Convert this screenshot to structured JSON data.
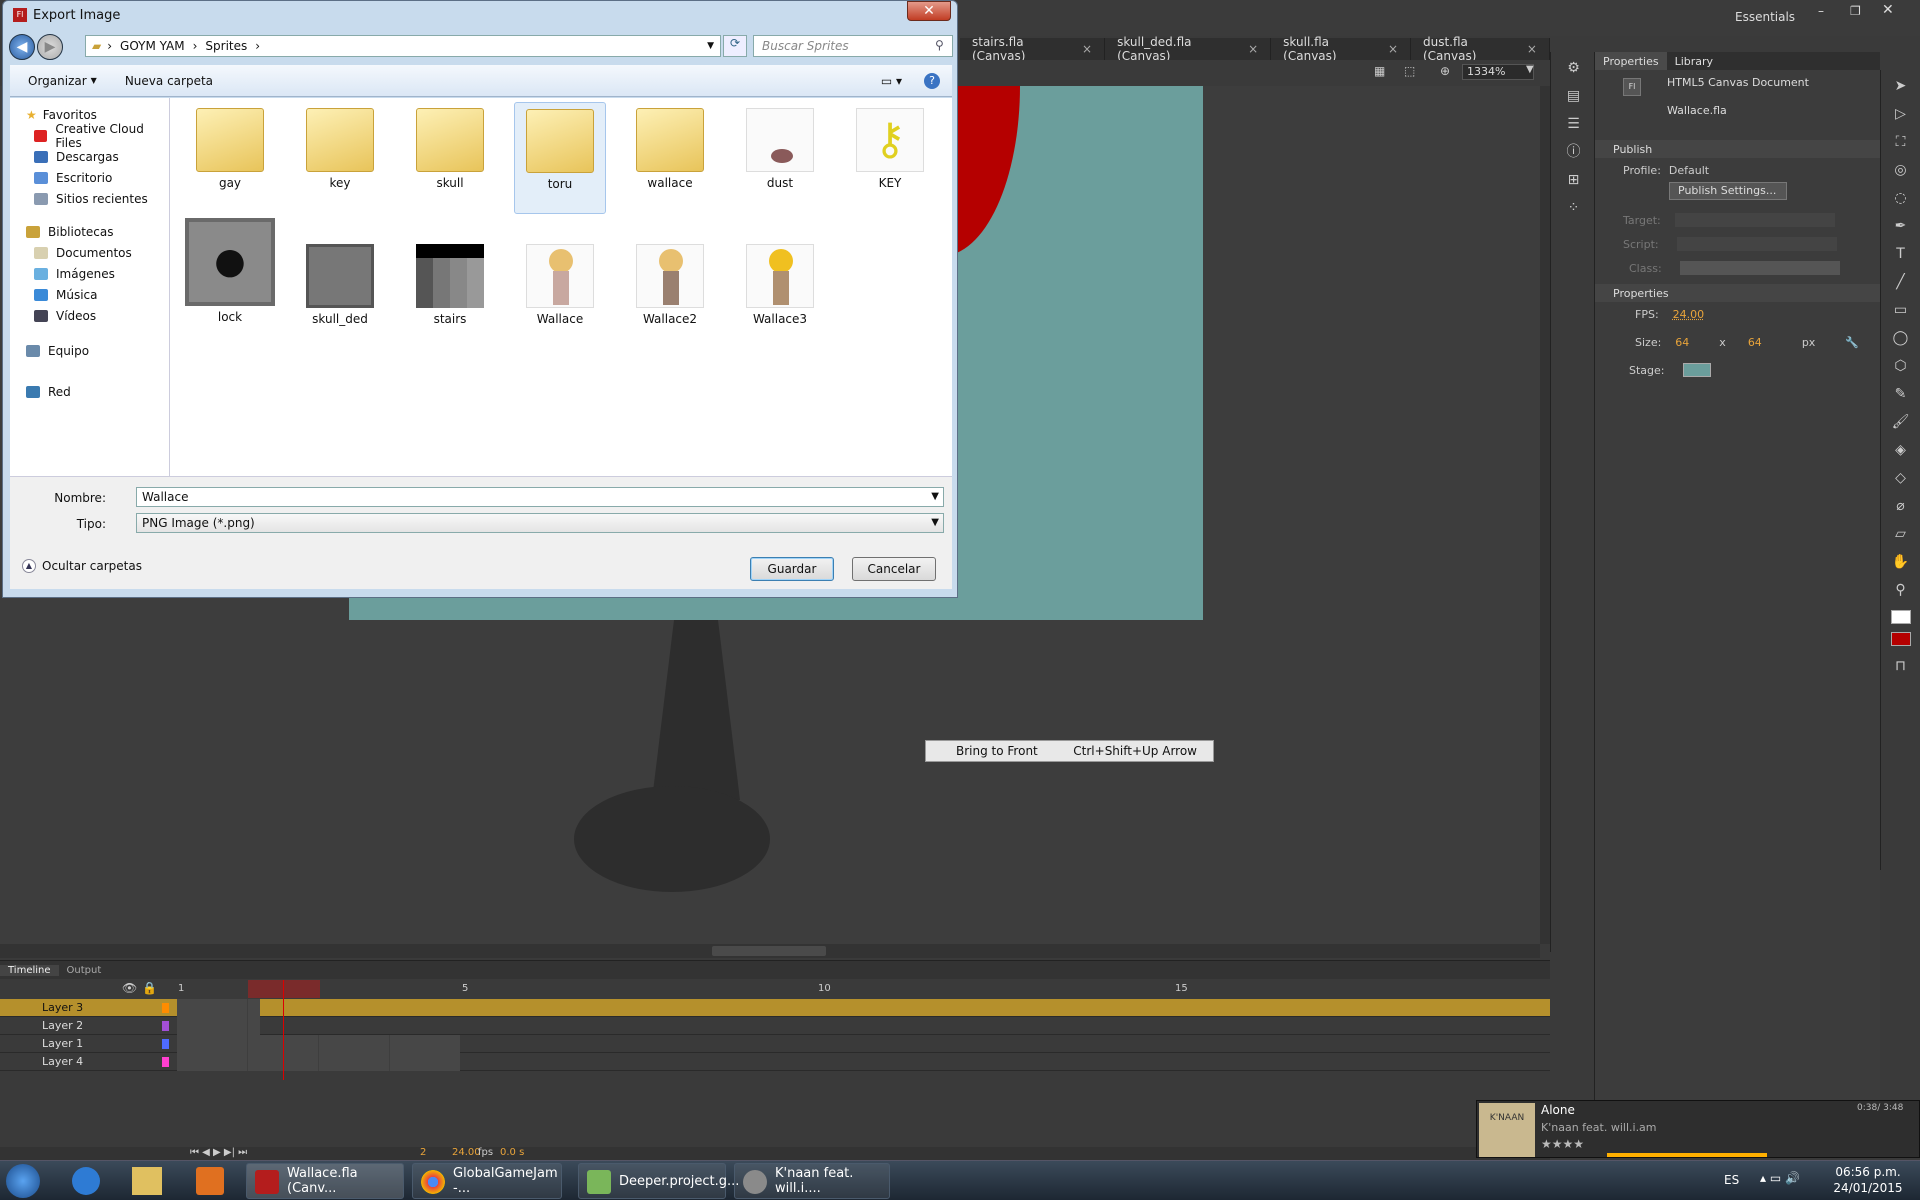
{
  "window_tabs": [
    "stairs.fla (Canvas)",
    "skull_ded.fla (Canvas)",
    "skull.fla (Canvas)",
    "dust.fla (Canvas)"
  ],
  "workspace": "Essentials",
  "zoom": "1334%",
  "context_menu": {
    "label": "Bring to Front",
    "shortcut": "Ctrl+Shift+Up Arrow"
  },
  "properties_panel": {
    "tabs": [
      "Properties",
      "Library"
    ],
    "doc_type": "HTML5 Canvas Document",
    "doc_name": "Wallace.fla",
    "publish_header": "Publish",
    "profile_label": "Profile:",
    "profile_value": "Default",
    "publish_settings": "Publish Settings...",
    "target_label": "Target:",
    "script_label": "Script:",
    "class_label": "Class:",
    "props_header": "Properties",
    "fps_label": "FPS:",
    "fps": "24.00",
    "size_label": "Size:",
    "width": "64",
    "x": "x",
    "height": "64",
    "px": "px",
    "stage_label": "Stage:",
    "stage_color": "#6b9e9c"
  },
  "timeline": {
    "tabs": [
      "Timeline",
      "Output"
    ],
    "frame_numbers": [
      "1",
      "5",
      "10",
      "15"
    ],
    "layers": [
      {
        "name": "Layer 3",
        "color": "#ff8c00"
      },
      {
        "name": "Layer 2",
        "color": "#a34fd6"
      },
      {
        "name": "Layer 1",
        "color": "#4f6bff"
      },
      {
        "name": "Layer 4",
        "color": "#ff3fd0"
      }
    ],
    "current_frame": "2",
    "fps": "24.00",
    "fps_unit": "fps",
    "time": "0.0 s"
  },
  "taskbar": {
    "tasks": [
      "Wallace.fla (Canv...",
      "GlobalGameJam -...",
      "Deeper.project.g...",
      "K'naan feat. will.i...."
    ],
    "lang": "ES",
    "time": "06:56 p.m.",
    "date": "24/01/2015"
  },
  "music": {
    "title": "Alone",
    "artist": "K'naan feat. will.i.am",
    "time": "0:38/ 3:48",
    "cover_text": "K'NAAN"
  },
  "dialog": {
    "title": "Export Image",
    "breadcrumb": [
      "GOYM YAM",
      "Sprites"
    ],
    "search_placeholder": "Buscar Sprites",
    "organize": "Organizar",
    "new_folder": "Nueva carpeta",
    "nav": {
      "favorites": "Favoritos",
      "fav_items": [
        "Creative Cloud Files",
        "Descargas",
        "Escritorio",
        "Sitios recientes"
      ],
      "libraries": "Bibliotecas",
      "lib_items": [
        "Documentos",
        "Imágenes",
        "Música",
        "Vídeos"
      ],
      "computer": "Equipo",
      "network": "Red"
    },
    "files": [
      "gay",
      "key",
      "skull",
      "toru",
      "wallace",
      "dust",
      "KEY",
      "lock",
      "skull_ded",
      "stairs",
      "Wallace",
      "Wallace2",
      "Wallace3"
    ],
    "name_label": "Nombre:",
    "name_value": "Wallace",
    "type_label": "Tipo:",
    "type_value": "PNG Image (*.png)",
    "hide_folders": "Ocultar carpetas",
    "save": "Guardar",
    "cancel": "Cancelar"
  }
}
